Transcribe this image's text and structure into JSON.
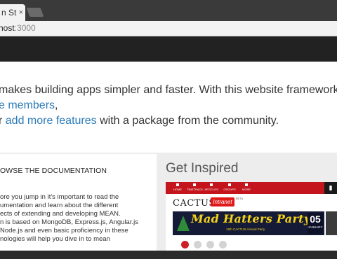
{
  "browser": {
    "tab_title": "n St",
    "tab_close": "×",
    "address_host": "host",
    "address_port": ":3000"
  },
  "intro": {
    "line1": "makes building apps simpler and faster. With this website framework",
    "line2_link": "e members",
    "line2_suffix": ",",
    "line3_prefix": "r ",
    "line3_link": "add more features",
    "line3_suffix": " with a package from the community."
  },
  "docs": {
    "title": "OWSE THE DOCUMENTATION",
    "lines": [
      "ore you jump in it's important to read the",
      "umentation and learn about the different",
      "ects of extending and developing MEAN.",
      "n is based on MongoDB, Express.js, Angular.js",
      "Node.js and even basic proficiency in these",
      "nologies will help you dive in to mean"
    ]
  },
  "inspired": {
    "title": "Get Inspired"
  },
  "showcase": {
    "nav_items": [
      "HOME",
      "TIMETRACK",
      "ARTICLES",
      "GROUPS",
      "MORE"
    ],
    "logo_text": "CACTUS",
    "logo_tag": "Intranet",
    "logo_beta": "BETA",
    "banner_title": "Mad Hatters Party",
    "banner_subtitle": "15th CACTUS Annual Party",
    "date_day": "05",
    "date_month": "JANUARY",
    "colors": {
      "nav_red": "#c4151c",
      "banner_navy": "#151b36",
      "banner_yellow": "#f6d31b"
    }
  },
  "colors": {
    "link": "#2a7ab8",
    "navbar": "#222222",
    "grey_band": "#ededed"
  }
}
